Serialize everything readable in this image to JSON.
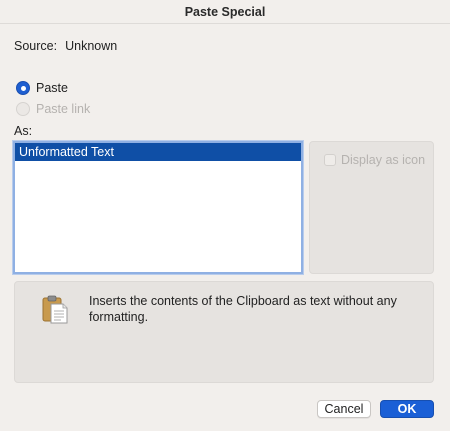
{
  "window": {
    "title": "Paste Special"
  },
  "source": {
    "label": "Source:",
    "value": "Unknown"
  },
  "paste_options": [
    {
      "label": "Paste",
      "checked": true,
      "enabled": true
    },
    {
      "label": "Paste link",
      "checked": false,
      "enabled": false
    }
  ],
  "as_label": "As:",
  "formats": [
    "Unformatted Text"
  ],
  "selected_format": "Unformatted Text",
  "display_as_icon": {
    "label": "Display as icon",
    "checked": false,
    "enabled": false
  },
  "description": "Inserts the contents of the Clipboard as text without any formatting.",
  "buttons": {
    "cancel": "Cancel",
    "ok": "OK"
  },
  "colors": {
    "accent": "#1a5fd6",
    "selection": "#0f4fa6"
  },
  "icons": {
    "description_icon": "clipboard-paste-icon"
  }
}
